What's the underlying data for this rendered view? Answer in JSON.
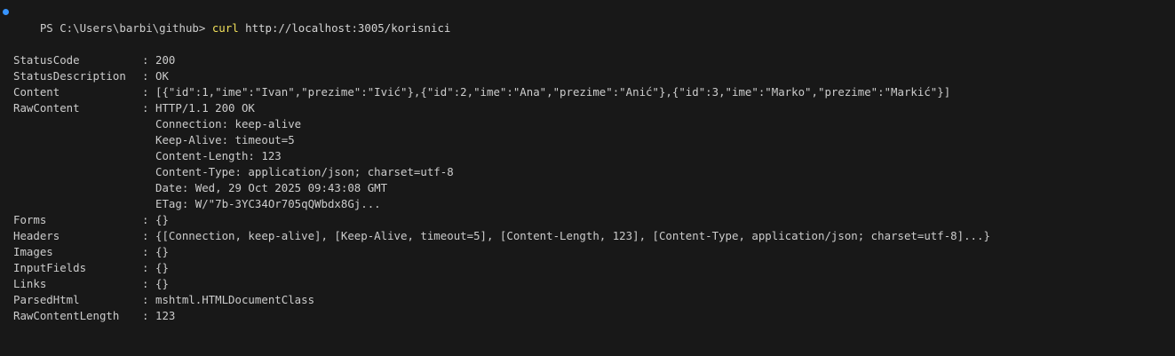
{
  "terminal": {
    "prompt": "PS C:\\Users\\barbi\\github> ",
    "command_name": "curl",
    "command_arg": " http://localhost:3005/korisnici",
    "separator": ": ",
    "fields": [
      {
        "name": "StatusCode",
        "value": "200"
      },
      {
        "name": "StatusDescription",
        "value": "OK"
      },
      {
        "name": "Content",
        "value": "[{\"id\":1,\"ime\":\"Ivan\",\"prezime\":\"Ivić\"},{\"id\":2,\"ime\":\"Ana\",\"prezime\":\"Anić\"},{\"id\":3,\"ime\":\"Marko\",\"prezime\":\"Markić\"}]"
      },
      {
        "name": "RawContent",
        "value": "HTTP/1.1 200 OK"
      }
    ],
    "raw_content_lines": [
      "Connection: keep-alive",
      "Keep-Alive: timeout=5",
      "Content-Length: 123",
      "Content-Type: application/json; charset=utf-8",
      "Date: Wed, 29 Oct 2025 09:43:08 GMT",
      "ETag: W/\"7b-3YC34Or705qQWbdx8Gj..."
    ],
    "fields_after": [
      {
        "name": "Forms",
        "value": "{}"
      },
      {
        "name": "Headers",
        "value": "{[Connection, keep-alive], [Keep-Alive, timeout=5], [Content-Length, 123], [Content-Type, application/json; charset=utf-8]...}"
      },
      {
        "name": "Images",
        "value": "{}"
      },
      {
        "name": "InputFields",
        "value": "{}"
      },
      {
        "name": "Links",
        "value": "{}"
      },
      {
        "name": "ParsedHtml",
        "value": "mshtml.HTMLDocumentClass"
      },
      {
        "name": "RawContentLength",
        "value": "123"
      }
    ]
  },
  "colors": {
    "background": "#181818",
    "text": "#cccccc",
    "command": "#f1e05a",
    "prompt_dot": "#3794ff"
  }
}
